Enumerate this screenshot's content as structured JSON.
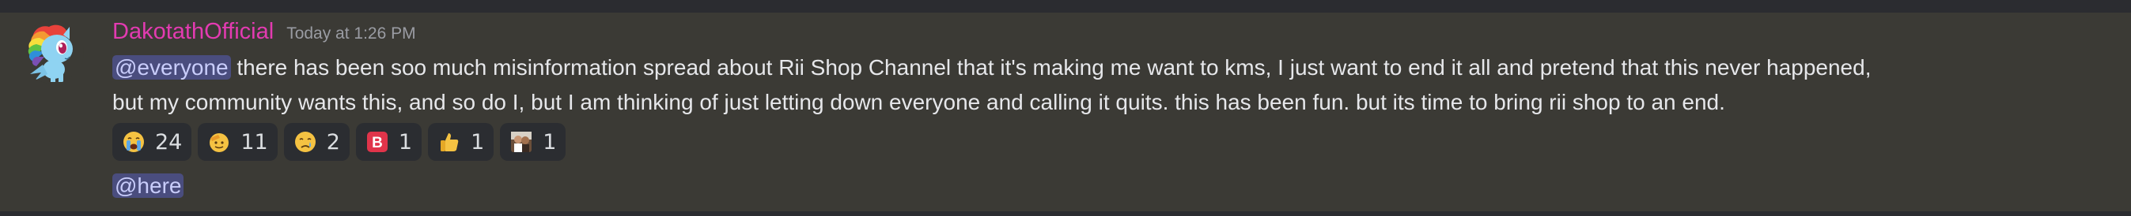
{
  "message": {
    "username": "DakotathOfficial",
    "timestamp": "Today at 1:26 PM",
    "username_color": "#e33bb1",
    "avatar_icon": "rainbow-pony-avatar",
    "mention": "@everyone",
    "line1_text": " there has been soo much misinformation spread about Rii Shop Channel that it's making me want to kms,  I just want to end it all and pretend that this never happened,",
    "line2_text": "but my community wants this, and so do I, but I am thinking of just letting down everyone and calling it quits. this has been fun. but its time to bring rii shop to an end."
  },
  "reactions": [
    {
      "icon": "loudly-crying-face-icon",
      "count": "24"
    },
    {
      "icon": "saluting-face-icon",
      "count": "11"
    },
    {
      "icon": "crying-face-icon",
      "count": "2"
    },
    {
      "icon": "b-button-icon",
      "count": "1"
    },
    {
      "icon": "thumbs-up-icon",
      "count": "1"
    },
    {
      "icon": "custom-image-emoji-icon",
      "count": "1"
    }
  ],
  "followup": {
    "mention": "@here"
  },
  "colors": {
    "background": "#3b3a35",
    "mention_bg": "#4a4d7e",
    "mention_text": "#c9cdfb",
    "reaction_bg": "#2b2d31"
  }
}
